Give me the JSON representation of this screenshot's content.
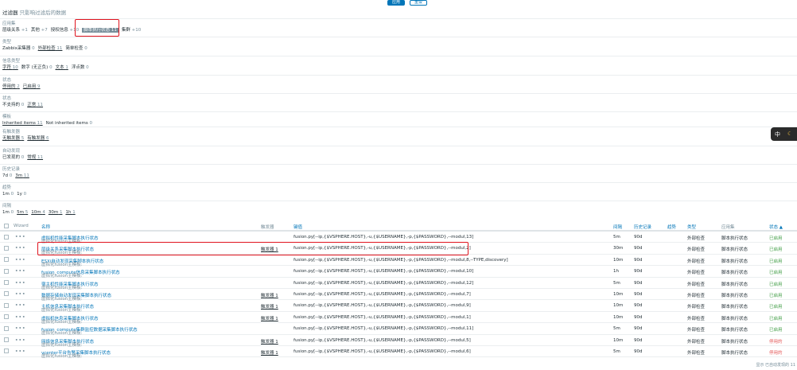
{
  "toolbar": {
    "apply_label": "应用",
    "reset_label": "重设"
  },
  "filter": {
    "title": "过滤器",
    "subtitle": "只影响过滤后的数据"
  },
  "sections": [
    {
      "title": "应用集",
      "items": [
        {
          "label": "层级关系",
          "count": "+1"
        },
        {
          "label": "其他",
          "count": "+7"
        },
        {
          "label": "授权信息",
          "count": "+10"
        },
        {
          "label": "脚本执行状态",
          "count": "11",
          "selected": true
        },
        {
          "label": "集群",
          "count": "+10"
        }
      ]
    },
    {
      "title": "类型",
      "items": [
        {
          "label": "Zabbix采集器",
          "count": "0"
        },
        {
          "label": "外部检查",
          "count": "11",
          "underline": true
        },
        {
          "label": "简单检查",
          "count": "0"
        }
      ]
    },
    {
      "title": "信息类型",
      "items": [
        {
          "label": "字符",
          "count": "10",
          "underline": true
        },
        {
          "label": "数字 (无正负)",
          "count": "0"
        },
        {
          "label": "文本",
          "count": "1",
          "underline": true
        },
        {
          "label": "浮点数",
          "count": "0"
        }
      ]
    },
    {
      "title": "状态",
      "items": [
        {
          "label": "停用的",
          "count": "2",
          "underline": true
        },
        {
          "label": "已启用",
          "count": "9",
          "underline": true
        }
      ]
    },
    {
      "title": "状态",
      "items": [
        {
          "label": "不支持的",
          "count": "0"
        },
        {
          "label": "正常",
          "count": "11",
          "underline": true
        }
      ]
    },
    {
      "title": "模板",
      "items": [
        {
          "label": "Inherited items",
          "count": "11",
          "underline": true
        },
        {
          "label": "Not inherited items",
          "count": "0"
        }
      ]
    },
    {
      "title": "有触发器",
      "items": [
        {
          "label": "无触发器",
          "count": "5",
          "underline": true
        },
        {
          "label": "有触发器",
          "count": "6",
          "underline": true
        }
      ]
    },
    {
      "title": "自动发现",
      "items": [
        {
          "label": "已发现的",
          "count": "0"
        },
        {
          "label": "常规",
          "count": "11",
          "underline": true
        }
      ]
    },
    {
      "title": "历史记录",
      "items": [
        {
          "label": "7d",
          "count": "0"
        },
        {
          "label": "3m",
          "count": "11",
          "underline": true
        }
      ]
    },
    {
      "title": "趋势",
      "items": [
        {
          "label": "1m",
          "count": "0"
        },
        {
          "label": "1y",
          "count": "0"
        }
      ]
    },
    {
      "title": "间隔",
      "items": [
        {
          "label": "1m",
          "count": "0"
        },
        {
          "label": "5m",
          "count": "5",
          "underline": true
        },
        {
          "label": "10m",
          "count": "4",
          "underline": true
        },
        {
          "label": "30m",
          "count": "1",
          "underline": true
        },
        {
          "label": "1h",
          "count": "1",
          "underline": true
        }
      ]
    }
  ],
  "widget": {
    "lang": "中",
    "moon": "☾"
  },
  "table": {
    "headers": {
      "wizard": "Wizard",
      "name": "名称",
      "triggers": "触发器",
      "key": "键值",
      "interval": "间隔",
      "history": "历史记录",
      "trends": "趋势",
      "type": "类型",
      "apps": "应用集",
      "status": "状态 ▲"
    },
    "rows": [
      {
        "prefix": "虚拟化fusion主模板: ",
        "name": "虚拟机性能采集脚本执行状态",
        "triggers": "",
        "key": "fusion.py[--ip,{$VSPHERE.HOST},-u,{$USERNAME},-p,{$PASSWORD},--modul,13]",
        "interval": "5m",
        "history": "90d",
        "trends": "",
        "type": "外部检查",
        "app": "脚本执行状态",
        "status": "已启用",
        "status_on": true
      },
      {
        "prefix": "虚拟化fusion主模板: ",
        "name": "层级关系采集脚本执行状态",
        "triggers": "触发器 1",
        "key": "fusion.py[--ip,{$VSPHERE.HOST},-u,{$USERNAME},-p,{$PASSWORD},--modul,2]",
        "interval": "30m",
        "history": "90d",
        "trends": "",
        "type": "外部检查",
        "app": "脚本执行状态",
        "status": "已启用",
        "status_on": true
      },
      {
        "prefix": "虚拟化fusion主模板: ",
        "name": "ESXi自动发现采集脚本执行状态",
        "triggers": "",
        "key": "fusion.py[--ip,{$VSPHERE.HOST},-u,{$USERNAME},-p,{$PASSWORD},--modul,8,--TYPE,discovery]",
        "interval": "10m",
        "history": "90d",
        "trends": "",
        "type": "外部检查",
        "app": "脚本执行状态",
        "status": "已启用",
        "status_on": true
      },
      {
        "prefix": "虚拟化fusion主模板: ",
        "name": "fusion_compute信息采集脚本执行状态",
        "triggers": "",
        "key": "fusion.py[--ip,{$VSPHERE.HOST},-u,{$USERNAME},-p,{$PASSWORD},--modul,10]",
        "interval": "1h",
        "history": "90d",
        "trends": "",
        "type": "外部检查",
        "app": "脚本执行状态",
        "status": "已启用",
        "status_on": true
      },
      {
        "prefix": "虚拟化fusion主模板: ",
        "name": "宿主机性能采集脚本执行状态",
        "triggers": "",
        "key": "fusion.py[--ip,{$VSPHERE.HOST},-u,{$USERNAME},-p,{$PASSWORD},--modul,12]",
        "interval": "5m",
        "history": "90d",
        "trends": "",
        "type": "外部检查",
        "app": "脚本执行状态",
        "status": "已启用",
        "status_on": true
      },
      {
        "prefix": "虚拟化fusion主模板: ",
        "name": "数据存储自动发现采集脚本执行状态",
        "triggers": "触发器 1",
        "key": "fusion.py[--ip,{$VSPHERE.HOST},-u,{$USERNAME},-p,{$PASSWORD},--modul,7]",
        "interval": "10m",
        "history": "90d",
        "trends": "",
        "type": "外部检查",
        "app": "脚本执行状态",
        "status": "已启用",
        "status_on": true
      },
      {
        "prefix": "虚拟化fusion主模板: ",
        "name": "主机信息采集脚本执行状态",
        "triggers": "触发器 1",
        "key": "fusion.py[--ip,{$VSPHERE.HOST},-u,{$USERNAME},-p,{$PASSWORD},--modul,9]",
        "interval": "10m",
        "history": "90d",
        "trends": "",
        "type": "外部检查",
        "app": "脚本执行状态",
        "status": "已启用",
        "status_on": true
      },
      {
        "prefix": "虚拟化fusion主模板: ",
        "name": "虚拟机信息采集脚本执行状态",
        "triggers": "触发器 1",
        "key": "fusion.py[--ip,{$VSPHERE.HOST},-u,{$USERNAME},-p,{$PASSWORD},--modul,1]",
        "interval": "10m",
        "history": "90d",
        "trends": "",
        "type": "外部检查",
        "app": "脚本执行状态",
        "status": "已启用",
        "status_on": true
      },
      {
        "prefix": "虚拟化fusion主模板: ",
        "name": "fusion_compute集群监控数据采集脚本执行状态",
        "triggers": "",
        "key": "fusion.py[--ip,{$VSPHERE.HOST},-u,{$USERNAME},-p,{$PASSWORD},--modul,11]",
        "interval": "5m",
        "history": "90d",
        "trends": "",
        "type": "外部检查",
        "app": "脚本执行状态",
        "status": "已启用",
        "status_on": true
      },
      {
        "prefix": "虚拟化fusion主模板: ",
        "name": "网络信息采集脚本执行状态",
        "triggers": "触发器 1",
        "key": "fusion.py[--ip,{$VSPHERE.HOST},-u,{$USERNAME},-p,{$PASSWORD},--modul,5]",
        "interval": "10m",
        "history": "90d",
        "trends": "",
        "type": "外部检查",
        "app": "脚本执行状态",
        "status": "停用的",
        "status_on": false
      },
      {
        "prefix": "虚拟化fusion主模板: ",
        "name": "vcenter平台告警采集脚本执行状态",
        "triggers": "触发器 1",
        "key": "fusion.py[--ip,{$VSPHERE.HOST},-u,{$USERNAME},-p,{$PASSWORD},--modul,6]",
        "interval": "5m",
        "history": "90d",
        "trends": "",
        "type": "外部检查",
        "app": "脚本执行状态",
        "status": "停用的",
        "status_on": false
      }
    ]
  },
  "footer": {
    "text": "显示 已自动发现的 11"
  },
  "colors": {
    "accent": "#0275b8",
    "enabled": "#429e47",
    "disabled": "#e45959",
    "highlight": "#e0141e"
  }
}
